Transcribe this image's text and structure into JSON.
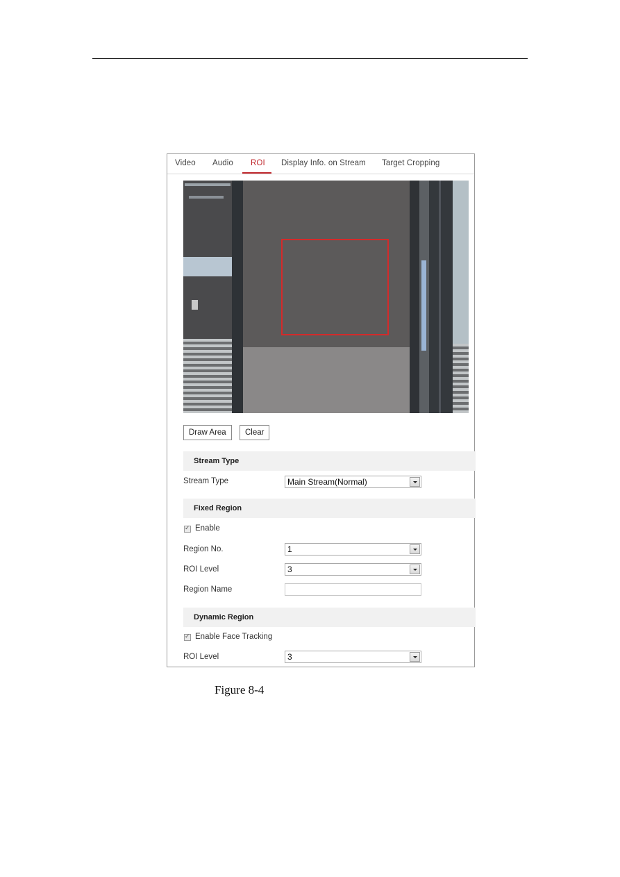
{
  "tabs": [
    {
      "label": "Video",
      "active": false
    },
    {
      "label": "Audio",
      "active": false
    },
    {
      "label": "ROI",
      "active": true
    },
    {
      "label": "Display Info. on Stream",
      "active": false
    },
    {
      "label": "Target Cropping",
      "active": false
    }
  ],
  "accent_color": "#c0282d",
  "video": {
    "roi_box_color": "#d42a2a"
  },
  "buttons": {
    "draw_area": "Draw Area",
    "clear": "Clear"
  },
  "stream_type_section": {
    "title": "Stream Type",
    "field_label": "Stream Type",
    "value": "Main Stream(Normal)"
  },
  "fixed_region_section": {
    "title": "Fixed Region",
    "enable_label": "Enable",
    "enable_checked": true,
    "region_no_label": "Region No.",
    "region_no_value": "1",
    "roi_level_label": "ROI Level",
    "roi_level_value": "3",
    "region_name_label": "Region Name",
    "region_name_value": ""
  },
  "dynamic_region_section": {
    "title": "Dynamic Region",
    "face_tracking_label": "Enable Face Tracking",
    "face_tracking_checked": true,
    "roi_level_label": "ROI Level",
    "roi_level_value": "3"
  },
  "caption": "Figure 8-4"
}
